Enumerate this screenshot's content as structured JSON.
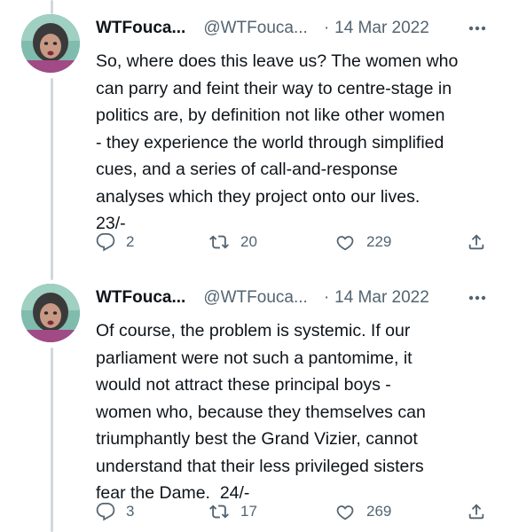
{
  "tweets": [
    {
      "display_name": "WTFouca...",
      "handle": "@WTFouca...",
      "separator": "·",
      "date": "14 Mar 2022",
      "text": "So, where does this leave us? The women who\ncan parry and feint their way to centre-stage in\npolitics are, by definition not like other women\n- they experience the world through simplified\ncues, and a series of call-and-response\nanalyses which they project onto our lives.\n23/-",
      "replies": "2",
      "retweets": "20",
      "likes": "229"
    },
    {
      "display_name": "WTFouca...",
      "handle": "@WTFouca...",
      "separator": "·",
      "date": "14 Mar 2022",
      "text": "Of course, the problem is systemic. If our\nparliament were not such a pantomime, it\nwould not attract these principal boys -\nwomen who, because they themselves can\ntriumphantly best the Grand Vizier, cannot\nunderstand that their less privileged sisters\nfear the Dame.  24/-",
      "replies": "3",
      "retweets": "17",
      "likes": "269"
    }
  ],
  "icons": {
    "reply": "reply-icon",
    "retweet": "retweet-icon",
    "like": "heart-icon",
    "share": "share-icon",
    "more": "more-icon"
  },
  "colors": {
    "text": "#0f1419",
    "muted": "#536471",
    "thread_line": "#cfd9de"
  }
}
